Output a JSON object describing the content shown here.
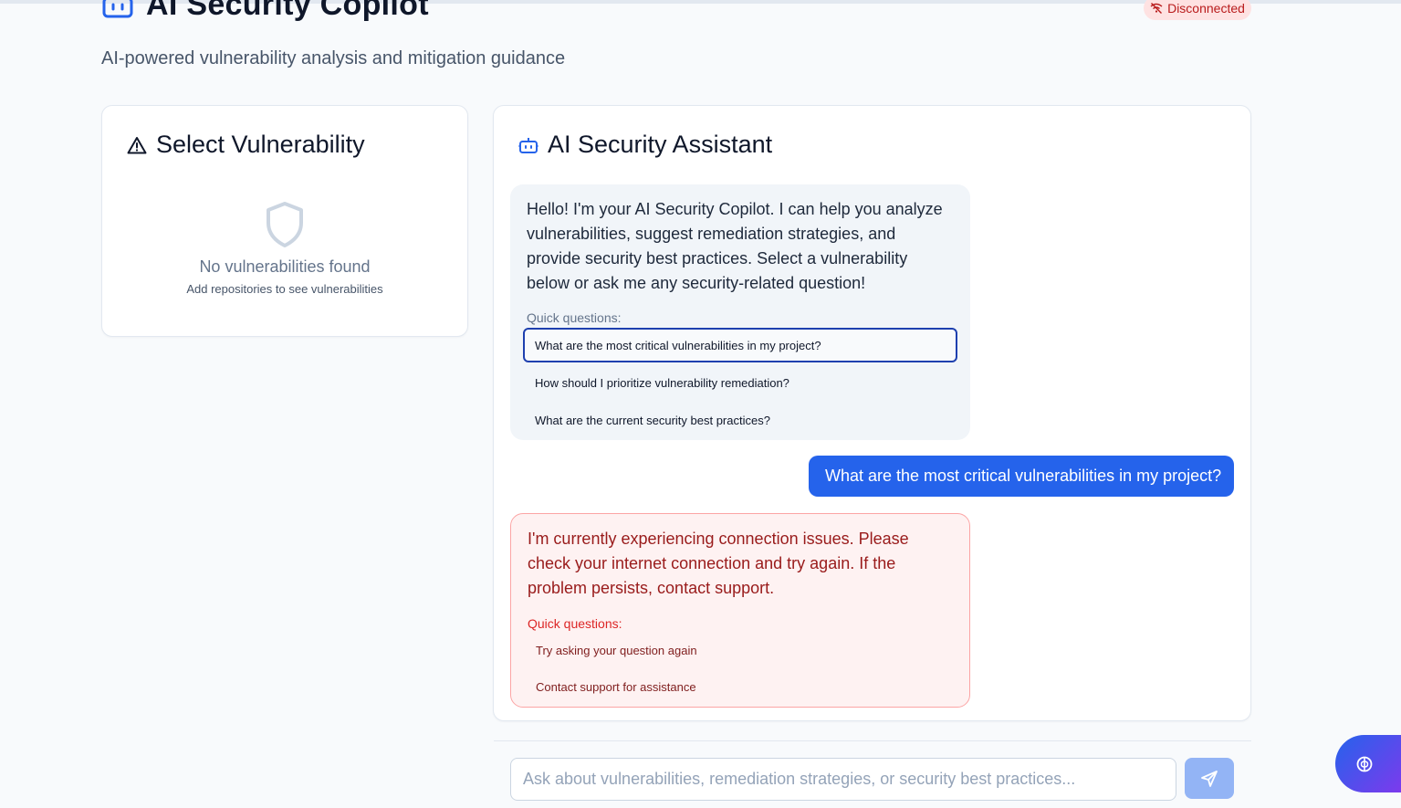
{
  "header": {
    "title": "AI Security Copilot",
    "subtitle": "AI-powered vulnerability analysis and mitigation guidance",
    "status": "Disconnected",
    "icon": "robot-icon",
    "status_icon": "wifi-off-icon"
  },
  "vulnerability_panel": {
    "title": "Select Vulnerability",
    "icon": "alert-triangle-icon",
    "empty_title": "No vulnerabilities found",
    "empty_hint": "Add repositories to see vulnerabilities"
  },
  "assistant_panel": {
    "title": "AI Security Assistant",
    "icon": "bot-icon",
    "messages": [
      {
        "role": "assistant",
        "text": "Hello! I'm your AI Security Copilot. I can help you analyze vulnerabilities, suggest remediation strategies, and provide security best practices. Select a vulnerability below or ask me any security-related question!",
        "quick_label": "Quick questions:",
        "quick_questions": [
          "What are the most critical vulnerabilities in my project?",
          "How should I prioritize vulnerability remediation?",
          "What are the current security best practices?"
        ]
      },
      {
        "role": "user",
        "text": "What are the most critical vulnerabilities in my project?"
      },
      {
        "role": "error",
        "text": "I'm currently experiencing connection issues. Please check your internet connection and try again. If the problem persists, contact support.",
        "quick_label": "Quick questions:",
        "quick_questions": [
          "Try asking your question again",
          "Contact support for assistance"
        ]
      }
    ]
  },
  "input": {
    "placeholder": "Ask about vulnerabilities, remediation strategies, or security best practices...",
    "value": ""
  },
  "colors": {
    "primary": "#2563eb",
    "error_text": "#991b1b",
    "error_bg": "#fef2f2",
    "badge_bg": "#fee2e2"
  }
}
